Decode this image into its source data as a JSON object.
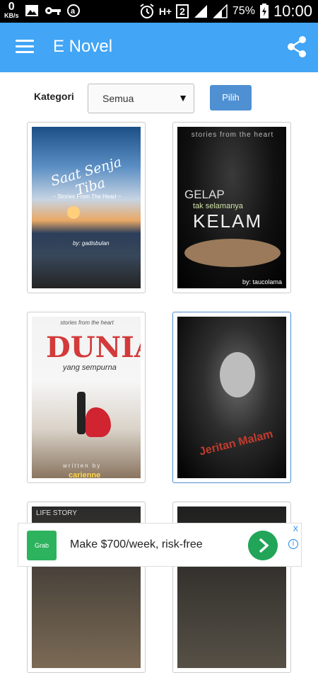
{
  "statusbar": {
    "speed_value": "0",
    "speed_unit": "KB/s",
    "network": "H+",
    "sim": "2",
    "battery": "75%",
    "time": "10:00"
  },
  "appbar": {
    "title": "E Novel",
    "menu_icon": "hamburger-menu-icon",
    "share_icon": "share-icon"
  },
  "filter": {
    "label": "Kategori",
    "selected": "Semua",
    "button": "Pilih"
  },
  "books": [
    {
      "title_line1": "Saat Senja Tiba",
      "tagline": "~ Stories From The Heart ~",
      "author": "by: gadisbulan"
    },
    {
      "top": "stories from the heart",
      "title_line1": "GELAP",
      "title_mid": "tak selamanya",
      "title_line2": "KELAM",
      "author": "by: taucolama"
    },
    {
      "top": "stories from the heart",
      "title_line1": "DUNIA",
      "title_mid": "yang sempurna",
      "written": "written by",
      "author": "carienne"
    },
    {
      "title_line1": "Jeritan Malam"
    },
    {
      "title_line1": "LIFE STORY"
    },
    {
      "title_line1": ""
    }
  ],
  "ad": {
    "logo": "Grab",
    "text": "Make $700/week, risk-free",
    "close": "X",
    "info": "i"
  },
  "colors": {
    "appbar": "#42a5f5",
    "button": "#4f90d3",
    "ad_green": "#22a459"
  }
}
